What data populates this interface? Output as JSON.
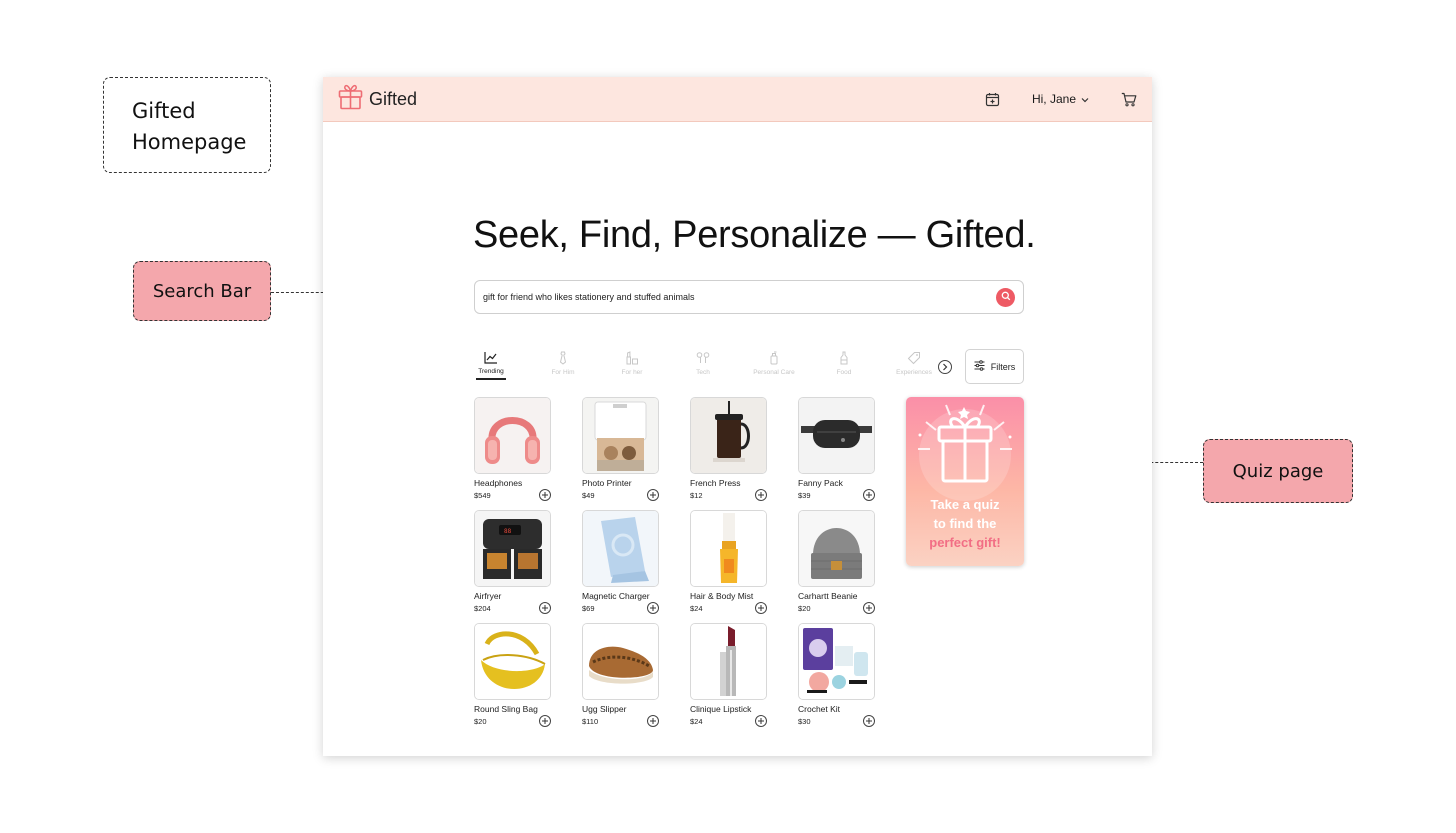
{
  "annotations": {
    "title_line1": "Gifted",
    "title_line2": "Homepage",
    "search_bar": "Search Bar",
    "quiz_page": "Quiz page"
  },
  "header": {
    "brand": "Gifted",
    "greeting": "Hi, Jane",
    "icons": [
      "gift-logo-icon",
      "calendar-plus-icon",
      "chevron-down-icon",
      "cart-icon"
    ]
  },
  "hero": {
    "headline": "Seek, Find, Personalize — Gifted."
  },
  "search": {
    "value": "gift for friend who likes stationery and stuffed animals",
    "button_icon": "search-icon"
  },
  "categories": [
    {
      "label": "Trending",
      "icon": "trending-icon",
      "active": true
    },
    {
      "label": "For Him",
      "icon": "tie-icon",
      "active": false
    },
    {
      "label": "For her",
      "icon": "lipstick-icon",
      "active": false
    },
    {
      "label": "Tech",
      "icon": "earbuds-icon",
      "active": false
    },
    {
      "label": "Personal Care",
      "icon": "lotion-icon",
      "active": false
    },
    {
      "label": "Food",
      "icon": "bottle-icon",
      "active": false
    },
    {
      "label": "Experiences",
      "icon": "ticket-icon",
      "active": false
    }
  ],
  "filters_label": "Filters",
  "products": [
    {
      "name": "Headphones",
      "price": "$549"
    },
    {
      "name": "Photo Printer",
      "price": "$49"
    },
    {
      "name": "French Press",
      "price": "$12"
    },
    {
      "name": "Fanny Pack",
      "price": "$39"
    },
    {
      "name": "Airfryer",
      "price": "$204"
    },
    {
      "name": "Magnetic Charger",
      "price": "$69"
    },
    {
      "name": "Hair & Body Mist",
      "price": "$24"
    },
    {
      "name": "Carhartt Beanie",
      "price": "$20"
    },
    {
      "name": "Round Sling Bag",
      "price": "$20"
    },
    {
      "name": "Ugg Slipper",
      "price": "$110"
    },
    {
      "name": "Clinique Lipstick",
      "price": "$24"
    },
    {
      "name": "Crochet Kit",
      "price": "$30"
    }
  ],
  "quiz_card": {
    "line1": "Take a quiz",
    "line2": "to find the",
    "line3": "perfect gift!"
  },
  "colors": {
    "header_bg": "#fde6df",
    "accent": "#ee5a64",
    "annotation_pink": "#f4a7ac"
  }
}
